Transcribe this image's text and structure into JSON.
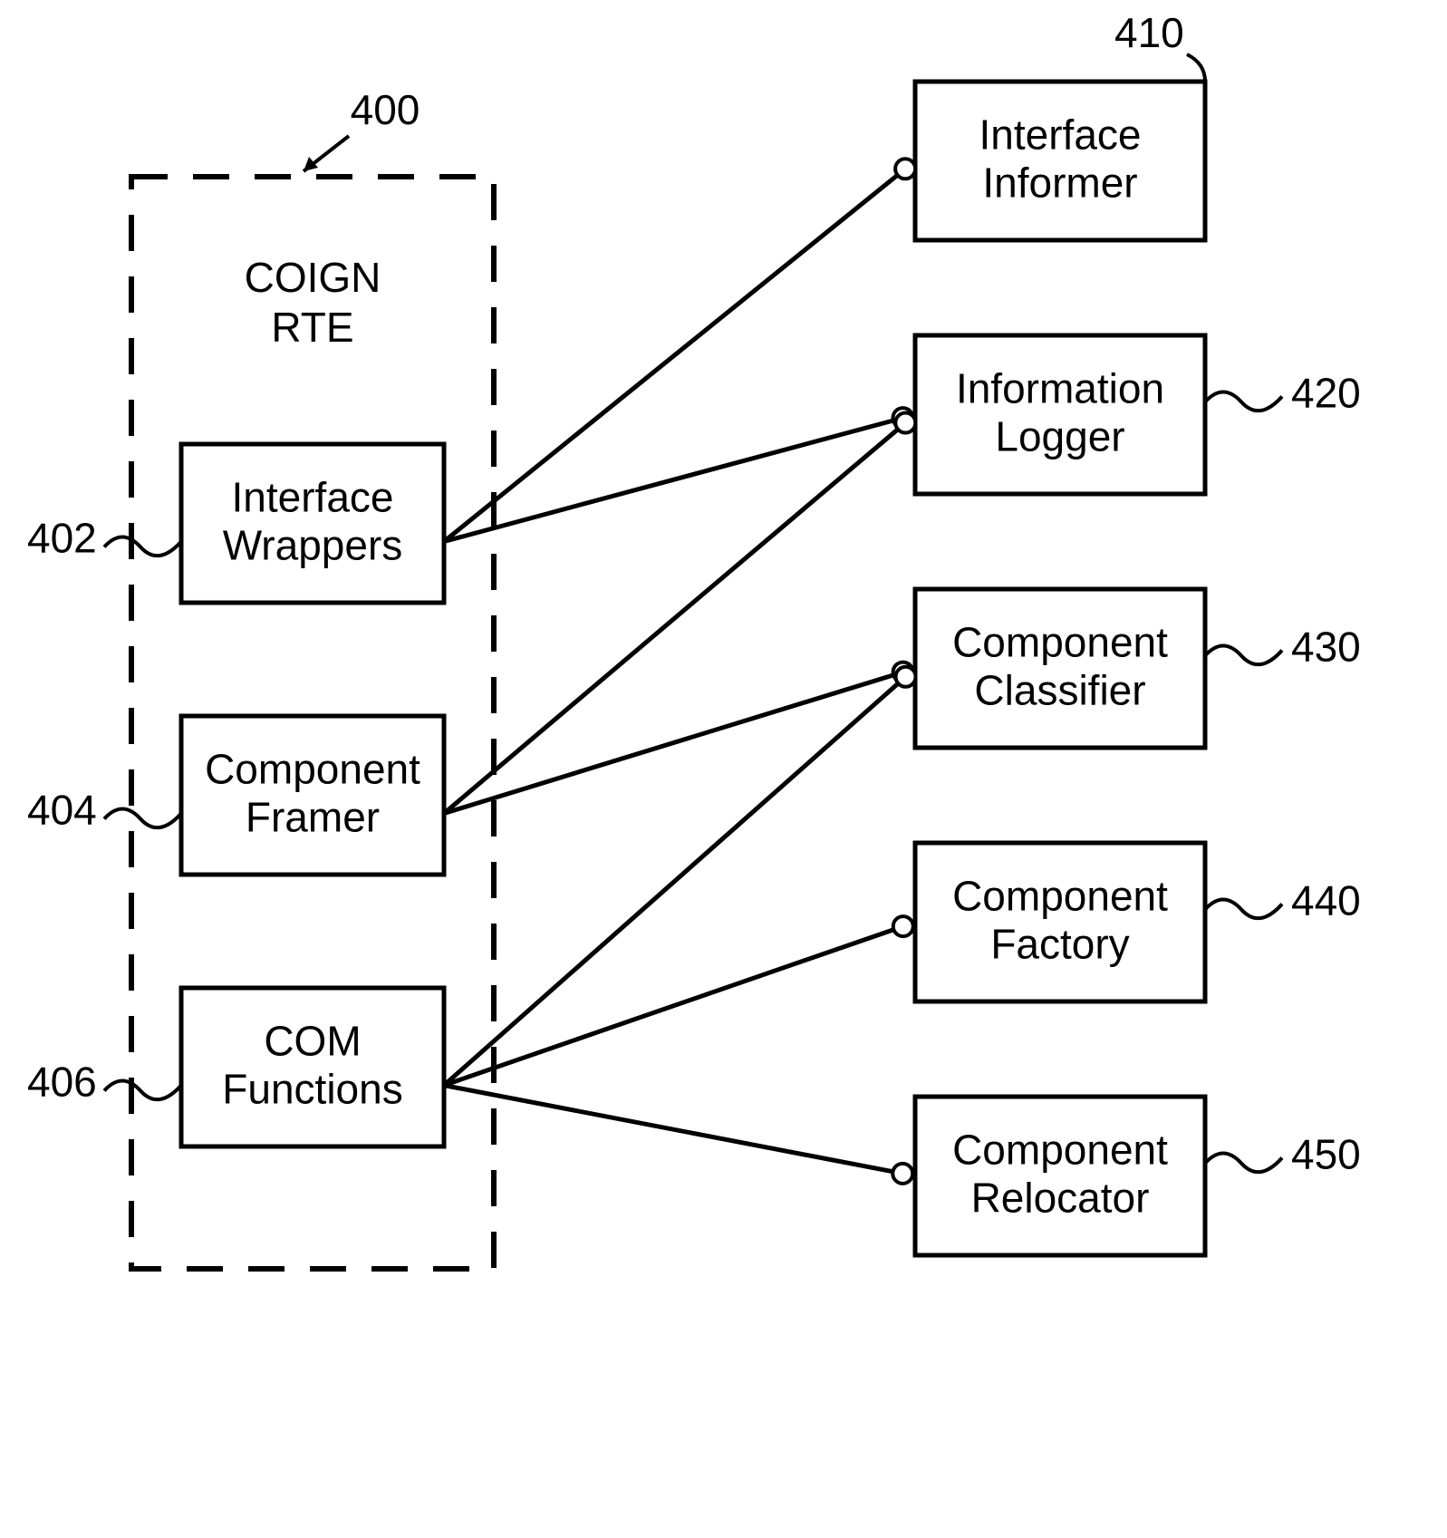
{
  "container": {
    "title_line1": "COIGN",
    "title_line2": "RTE",
    "ref": "400"
  },
  "left": [
    {
      "id": "interface-wrappers",
      "line1": "Interface",
      "line2": "Wrappers",
      "ref": "402"
    },
    {
      "id": "component-framer",
      "line1": "Component",
      "line2": "Framer",
      "ref": "404"
    },
    {
      "id": "com-functions",
      "line1": "COM",
      "line2": "Functions",
      "ref": "406"
    }
  ],
  "right": [
    {
      "id": "interface-informer",
      "line1": "Interface",
      "line2": "Informer",
      "ref": "410"
    },
    {
      "id": "information-logger",
      "line1": "Information",
      "line2": "Logger",
      "ref": "420"
    },
    {
      "id": "component-classifier",
      "line1": "Component",
      "line2": "Classifier",
      "ref": "430"
    },
    {
      "id": "component-factory",
      "line1": "Component",
      "line2": "Factory",
      "ref": "440"
    },
    {
      "id": "component-relocator",
      "line1": "Component",
      "line2": "Relocator",
      "ref": "450"
    }
  ],
  "edges": [
    {
      "from": "interface-wrappers",
      "to": "interface-informer"
    },
    {
      "from": "interface-wrappers",
      "to": "information-logger"
    },
    {
      "from": "component-framer",
      "to": "information-logger"
    },
    {
      "from": "component-framer",
      "to": "component-classifier"
    },
    {
      "from": "com-functions",
      "to": "component-classifier"
    },
    {
      "from": "com-functions",
      "to": "component-factory"
    },
    {
      "from": "com-functions",
      "to": "component-relocator"
    }
  ]
}
